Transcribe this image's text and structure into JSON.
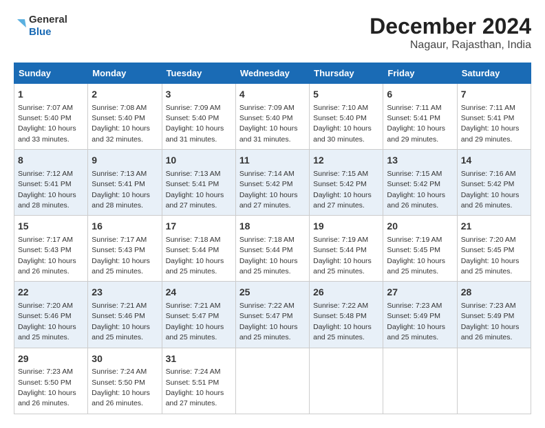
{
  "logo": {
    "line1": "General",
    "line2": "Blue"
  },
  "title": "December 2024",
  "subtitle": "Nagaur, Rajasthan, India",
  "columns": [
    "Sunday",
    "Monday",
    "Tuesday",
    "Wednesday",
    "Thursday",
    "Friday",
    "Saturday"
  ],
  "weeks": [
    [
      {
        "day": "1",
        "sunrise": "7:07 AM",
        "sunset": "5:40 PM",
        "daylight": "10 hours and 33 minutes."
      },
      {
        "day": "2",
        "sunrise": "7:08 AM",
        "sunset": "5:40 PM",
        "daylight": "10 hours and 32 minutes."
      },
      {
        "day": "3",
        "sunrise": "7:09 AM",
        "sunset": "5:40 PM",
        "daylight": "10 hours and 31 minutes."
      },
      {
        "day": "4",
        "sunrise": "7:09 AM",
        "sunset": "5:40 PM",
        "daylight": "10 hours and 31 minutes."
      },
      {
        "day": "5",
        "sunrise": "7:10 AM",
        "sunset": "5:40 PM",
        "daylight": "10 hours and 30 minutes."
      },
      {
        "day": "6",
        "sunrise": "7:11 AM",
        "sunset": "5:41 PM",
        "daylight": "10 hours and 29 minutes."
      },
      {
        "day": "7",
        "sunrise": "7:11 AM",
        "sunset": "5:41 PM",
        "daylight": "10 hours and 29 minutes."
      }
    ],
    [
      {
        "day": "8",
        "sunrise": "7:12 AM",
        "sunset": "5:41 PM",
        "daylight": "10 hours and 28 minutes."
      },
      {
        "day": "9",
        "sunrise": "7:13 AM",
        "sunset": "5:41 PM",
        "daylight": "10 hours and 28 minutes."
      },
      {
        "day": "10",
        "sunrise": "7:13 AM",
        "sunset": "5:41 PM",
        "daylight": "10 hours and 27 minutes."
      },
      {
        "day": "11",
        "sunrise": "7:14 AM",
        "sunset": "5:42 PM",
        "daylight": "10 hours and 27 minutes."
      },
      {
        "day": "12",
        "sunrise": "7:15 AM",
        "sunset": "5:42 PM",
        "daylight": "10 hours and 27 minutes."
      },
      {
        "day": "13",
        "sunrise": "7:15 AM",
        "sunset": "5:42 PM",
        "daylight": "10 hours and 26 minutes."
      },
      {
        "day": "14",
        "sunrise": "7:16 AM",
        "sunset": "5:42 PM",
        "daylight": "10 hours and 26 minutes."
      }
    ],
    [
      {
        "day": "15",
        "sunrise": "7:17 AM",
        "sunset": "5:43 PM",
        "daylight": "10 hours and 26 minutes."
      },
      {
        "day": "16",
        "sunrise": "7:17 AM",
        "sunset": "5:43 PM",
        "daylight": "10 hours and 25 minutes."
      },
      {
        "day": "17",
        "sunrise": "7:18 AM",
        "sunset": "5:44 PM",
        "daylight": "10 hours and 25 minutes."
      },
      {
        "day": "18",
        "sunrise": "7:18 AM",
        "sunset": "5:44 PM",
        "daylight": "10 hours and 25 minutes."
      },
      {
        "day": "19",
        "sunrise": "7:19 AM",
        "sunset": "5:44 PM",
        "daylight": "10 hours and 25 minutes."
      },
      {
        "day": "20",
        "sunrise": "7:19 AM",
        "sunset": "5:45 PM",
        "daylight": "10 hours and 25 minutes."
      },
      {
        "day": "21",
        "sunrise": "7:20 AM",
        "sunset": "5:45 PM",
        "daylight": "10 hours and 25 minutes."
      }
    ],
    [
      {
        "day": "22",
        "sunrise": "7:20 AM",
        "sunset": "5:46 PM",
        "daylight": "10 hours and 25 minutes."
      },
      {
        "day": "23",
        "sunrise": "7:21 AM",
        "sunset": "5:46 PM",
        "daylight": "10 hours and 25 minutes."
      },
      {
        "day": "24",
        "sunrise": "7:21 AM",
        "sunset": "5:47 PM",
        "daylight": "10 hours and 25 minutes."
      },
      {
        "day": "25",
        "sunrise": "7:22 AM",
        "sunset": "5:47 PM",
        "daylight": "10 hours and 25 minutes."
      },
      {
        "day": "26",
        "sunrise": "7:22 AM",
        "sunset": "5:48 PM",
        "daylight": "10 hours and 25 minutes."
      },
      {
        "day": "27",
        "sunrise": "7:23 AM",
        "sunset": "5:49 PM",
        "daylight": "10 hours and 25 minutes."
      },
      {
        "day": "28",
        "sunrise": "7:23 AM",
        "sunset": "5:49 PM",
        "daylight": "10 hours and 26 minutes."
      }
    ],
    [
      {
        "day": "29",
        "sunrise": "7:23 AM",
        "sunset": "5:50 PM",
        "daylight": "10 hours and 26 minutes."
      },
      {
        "day": "30",
        "sunrise": "7:24 AM",
        "sunset": "5:50 PM",
        "daylight": "10 hours and 26 minutes."
      },
      {
        "day": "31",
        "sunrise": "7:24 AM",
        "sunset": "5:51 PM",
        "daylight": "10 hours and 27 minutes."
      },
      null,
      null,
      null,
      null
    ]
  ],
  "labels": {
    "sunrise": "Sunrise:",
    "sunset": "Sunset:",
    "daylight": "Daylight:"
  }
}
